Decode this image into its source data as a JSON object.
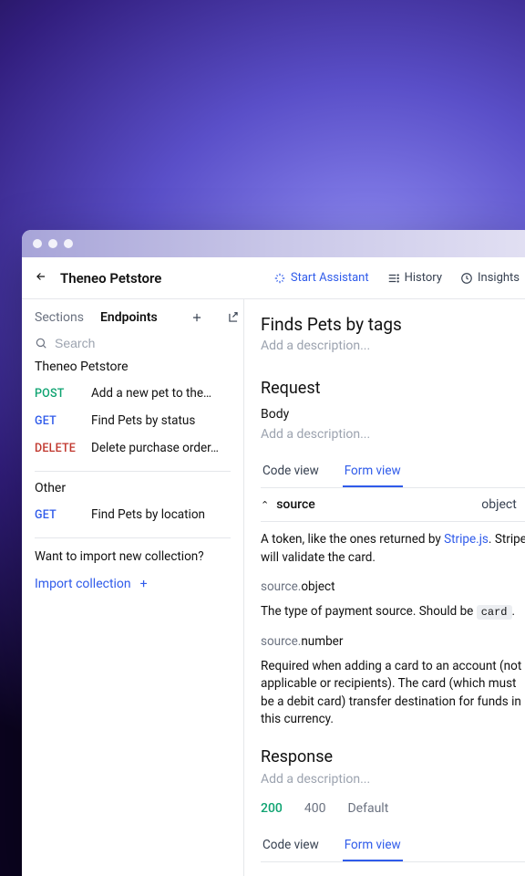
{
  "header": {
    "breadcrumb": "Theneo Petstore",
    "actions": {
      "assistant": "Start Assistant",
      "history": "History",
      "insights": "Insights"
    }
  },
  "sidebar": {
    "tabs": {
      "sections": "Sections",
      "endpoints": "Endpoints"
    },
    "search_placeholder": "Search",
    "groups": [
      {
        "title": "Theneo Petstore",
        "items": [
          {
            "method": "POST",
            "label": "Add a new pet to the…"
          },
          {
            "method": "GET",
            "label": "Find Pets by status"
          },
          {
            "method": "DELETE",
            "label": "Delete purchase order…"
          }
        ]
      },
      {
        "title": "Other",
        "items": [
          {
            "method": "GET",
            "label": "Find Pets by location"
          }
        ]
      }
    ],
    "import_question": "Want to import new collection?",
    "import_link": "Import collection"
  },
  "main": {
    "title": "Finds Pets by tags",
    "desc_placeholder": "Add a description...",
    "request": {
      "heading": "Request",
      "body_label": "Body",
      "body_placeholder": "Add a description...",
      "view_tabs": {
        "code": "Code view",
        "form": "Form view"
      },
      "root_param": {
        "name": "source",
        "type": "object",
        "desc_prefix": "A token, like the ones returned by ",
        "desc_link": "Stripe.js",
        "desc_suffix": ". Stripe will validate the card."
      },
      "fields": [
        {
          "path_prefix": "source.",
          "path_key": "object",
          "desc_before": "The type of payment source. Should be ",
          "code": "card",
          "desc_after": "."
        },
        {
          "path_prefix": "source.",
          "path_key": "number",
          "desc_before": "Required when adding a card to an account (not applicable or recipients). The card (which must be a debit card) transfer destination for funds in this currency.",
          "code": "",
          "desc_after": ""
        }
      ]
    },
    "response": {
      "heading": "Response",
      "placeholder": "Add a description...",
      "statuses": {
        "ok": "200",
        "err": "400",
        "default": "Default"
      },
      "view_tabs": {
        "code": "Code view",
        "form": "Form view"
      }
    }
  }
}
